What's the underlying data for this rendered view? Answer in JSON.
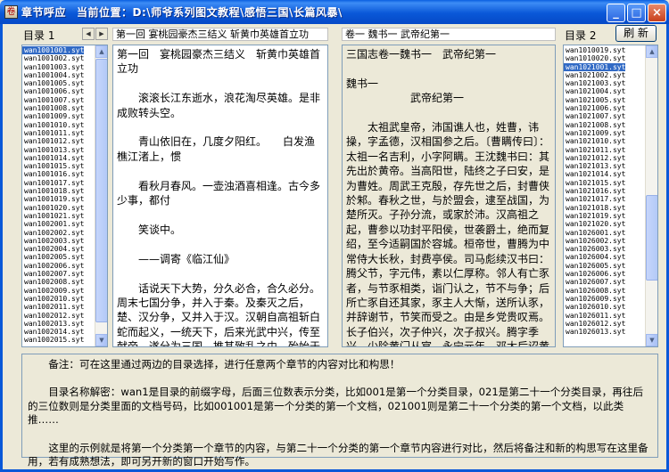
{
  "window": {
    "title": "章节呼应",
    "location_label": "当前位置：",
    "location_path": "D:\\师爷系列图文教程\\感悟三国\\长篇风暴\\",
    "app_icon": "scroll-app-icon",
    "minimize": "_",
    "maximize": "□",
    "close": "×"
  },
  "left_list": {
    "label": "目录 1",
    "items": [
      "wan1001001.syt",
      "wan1001002.syt",
      "wan1001003.syt",
      "wan1001004.syt",
      "wan1001005.syt",
      "wan1001006.syt",
      "wan1001007.syt",
      "wan1001008.syt",
      "wan1001009.syt",
      "wan1001010.syt",
      "wan1001011.syt",
      "wan1001012.syt",
      "wan1001013.syt",
      "wan1001014.syt",
      "wan1001015.syt",
      "wan1001016.syt",
      "wan1001017.syt",
      "wan1001018.syt",
      "wan1001019.syt",
      "wan1001020.syt",
      "wan1001021.syt",
      "wan1002001.syt",
      "wan1002002.syt",
      "wan1002003.syt",
      "wan1002004.syt",
      "wan1002005.syt",
      "wan1002006.syt",
      "wan1002007.syt",
      "wan1002008.syt",
      "wan1002009.syt",
      "wan1002010.syt",
      "wan1002011.syt",
      "wan1002012.syt",
      "wan1002013.syt",
      "wan1002014.syt",
      "wan1002015.syt"
    ],
    "selected_index": 0
  },
  "nav": {
    "prev": "◀",
    "next": "▶"
  },
  "left_pane": {
    "heading": "第一回  宴桃园豪杰三结义  斩黄巾英雄首立功",
    "text": "第一回　宴桃园豪杰三结义　斩黄巾英雄首立功\n\n　　滚滚长江东逝水，浪花淘尽英雄。是非成败转头空。\n\n　　青山依旧在，几度夕阳红。　　白发渔樵江渚上，惯\n\n　　看秋月春风。一壶浊酒喜相逢。古今多少事，都付\n\n　　笑谈中。\n\n　　——调寄《临江仙》\n\n　　话说天下大势，分久必合，合久必分。周末七国分争，并入于秦。及秦灭之后，楚、汉分争，又并入于汉。汉朝自高祖斩白蛇而起义，一统天下，后来光武中兴，传至献帝，遂分为三国。推其致乱之由，殆始于桓、灵二帝。桓帝禁锢善类，崇信宦官。及桓帝崩，灵帝即位，大将军窦武、太傅陈蕃共相辅佐。时有宦官曹节等弄权，窦武、陈蕃谋诛之，机事不密，反为所害，中涓自此愈横。"
  },
  "right_pane": {
    "heading": "卷一 魏书一  武帝纪第一",
    "text": "三国志卷一魏书一　武帝纪第一\n\n魏书一\n　　　　　　武帝纪第一\n\n　　太祖武皇帝，沛国谯人也，姓曹，讳操，字孟德，汉相国参之后。〔曹瞒传曰〕：太祖一名吉利，小字阿瞒。王沈魏书曰：其先出於黄帝。当高阳世，陆终之子曰安，是为曹姓。周武王克殷，存先世之后，封曹侠於邾。春秋之世，与於盟会，逮至战国，为楚所灭。子孙分流，或家於沛。汉高祖之起，曹参以功封平阳侯，世袭爵土，绝而复绍，至今适嗣国於容城。桓帝世，曹腾为中常侍大长秋，封费亭侯。司马彪续汉书曰：腾父节，字元伟，素以仁厚称。邻人有亡豕者，与节豕相类，诣门认之，节不与争；后所亡豕自还其家，豕主人大惭，送所认豕，并辞谢节，节笑而受之。由是乡党贵叹焉。长子伯兴，次子仲兴，次子叔兴。腾字季兴，少除黄门从官。永宁元年，邓太后诏黄门令选中黄门从官年少温谨者配皇太子书，腾应其选。太子特亲爱腾，饮食赏赐与众有异。顺帝即位，为小黄门，迁至中常侍大长秋。"
  },
  "right_list": {
    "label": "目录 2",
    "refresh": "刷 新",
    "items": [
      "wan1010019.syt",
      "wan1010020.syt",
      "wan1021001.syt",
      "wan1021002.syt",
      "wan1021003.syt",
      "wan1021004.syt",
      "wan1021005.syt",
      "wan1021006.syt",
      "wan1021007.syt",
      "wan1021008.syt",
      "wan1021009.syt",
      "wan1021010.syt",
      "wan1021011.syt",
      "wan1021012.syt",
      "wan1021013.syt",
      "wan1021014.syt",
      "wan1021015.syt",
      "wan1021016.syt",
      "wan1021017.syt",
      "wan1021018.syt",
      "wan1021019.syt",
      "wan1021020.syt",
      "wan1026001.syt",
      "wan1026002.syt",
      "wan1026003.syt",
      "wan1026004.syt",
      "wan1026005.syt",
      "wan1026006.syt",
      "wan1026007.syt",
      "wan1026008.syt",
      "wan1026009.syt",
      "wan1026010.syt",
      "wan1026011.syt",
      "wan1026012.syt",
      "wan1026013.syt"
    ],
    "selected_index": 2
  },
  "notes": {
    "text": "　　备注：可在这里通过两边的目录选择，进行任意两个章节的内容对比和构思！\n\n　　目录名称解密：wan1是目录的前缀字母，后面三位数表示分类，比如001是第一个分类目录，021是第二十一个分类目录，再往后的三位数则是分类里面的文档号码，比如001001是第一个分类的第一个文档，021001则是第二十一个分类的第一个文档，以此类推……\n\n　　这里的示例就是将第一个分类第一个章节的内容，与第二十一个分类的第一个章节内容进行对比，然后将备注和新的构思写在这里备用，若有成熟想法，即可另开新的窗口开始写作。"
  }
}
